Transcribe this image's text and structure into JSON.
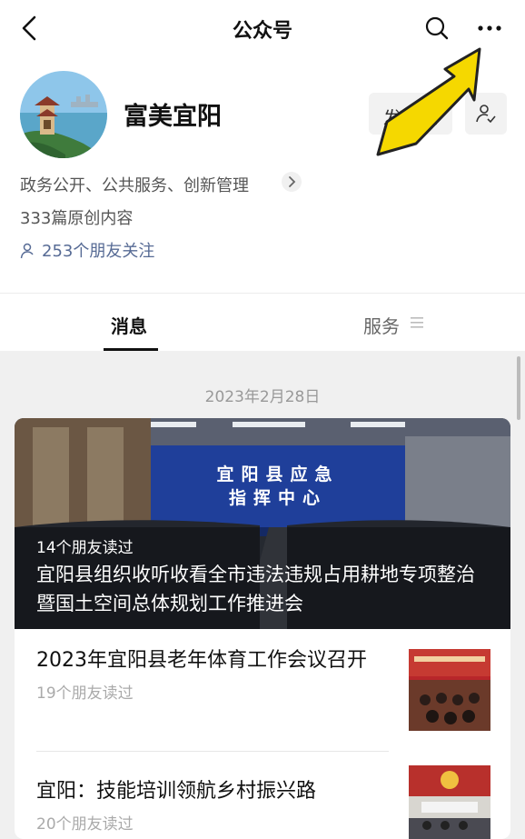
{
  "header": {
    "title": "公众号",
    "back_icon": "chevron-left-icon",
    "search_icon": "search-icon",
    "more_icon": "more-horizontal-icon"
  },
  "profile": {
    "name": "富美宜阳",
    "message_button": "发消息",
    "follow_icon": "user-check-icon",
    "description": "政务公开、公共服务、创新管理",
    "original_count": "333篇原创内容",
    "friends_following": "253个朋友关注"
  },
  "tabs": [
    {
      "label": "消息",
      "active": true
    },
    {
      "label": "服务",
      "active": false
    }
  ],
  "feed": {
    "date": "2023年2月28日",
    "hero": {
      "readers": "14个朋友读过",
      "title": "宜阳县组织收听收看全市违法违规占用耕地专项整治暨国土空间总体规划工作推进会",
      "banner_text": [
        "宜阳县应急",
        "指挥中心"
      ]
    },
    "items": [
      {
        "title": "2023年宜阳县老年体育工作会议召开",
        "readers": "19个朋友读过"
      },
      {
        "title": "宜阳：技能培训领航乡村振兴路",
        "readers": "20个朋友读过"
      }
    ]
  },
  "annotation": {
    "arrow_color": "#f5d800",
    "arrow_icon": "pointer-arrow-icon"
  }
}
